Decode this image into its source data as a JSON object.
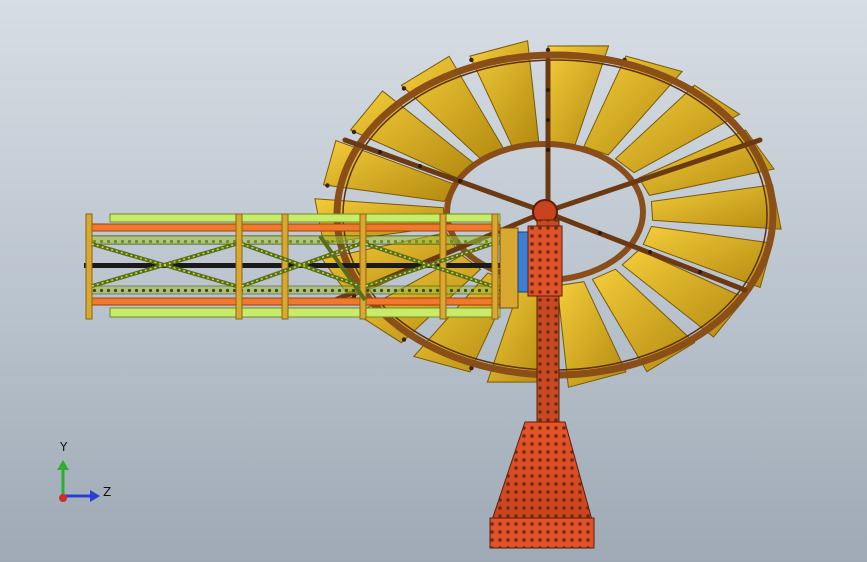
{
  "viewport": {
    "background_top": "#d7dde4",
    "background_bottom": "#9ea9b5"
  },
  "model": {
    "blade_color": "#e0b21a",
    "blade_shade": "#a8850c",
    "rim_color": "#8a4e18",
    "tail_green": "#c8ec6a",
    "tail_orange": "#f07a2c",
    "base_color": "#e0522a"
  },
  "triad": {
    "y_label": "Y",
    "z_label": "Z",
    "y_color": "#2fae2f",
    "z_color": "#2b3fd1",
    "x_color": "#d12b2b"
  }
}
